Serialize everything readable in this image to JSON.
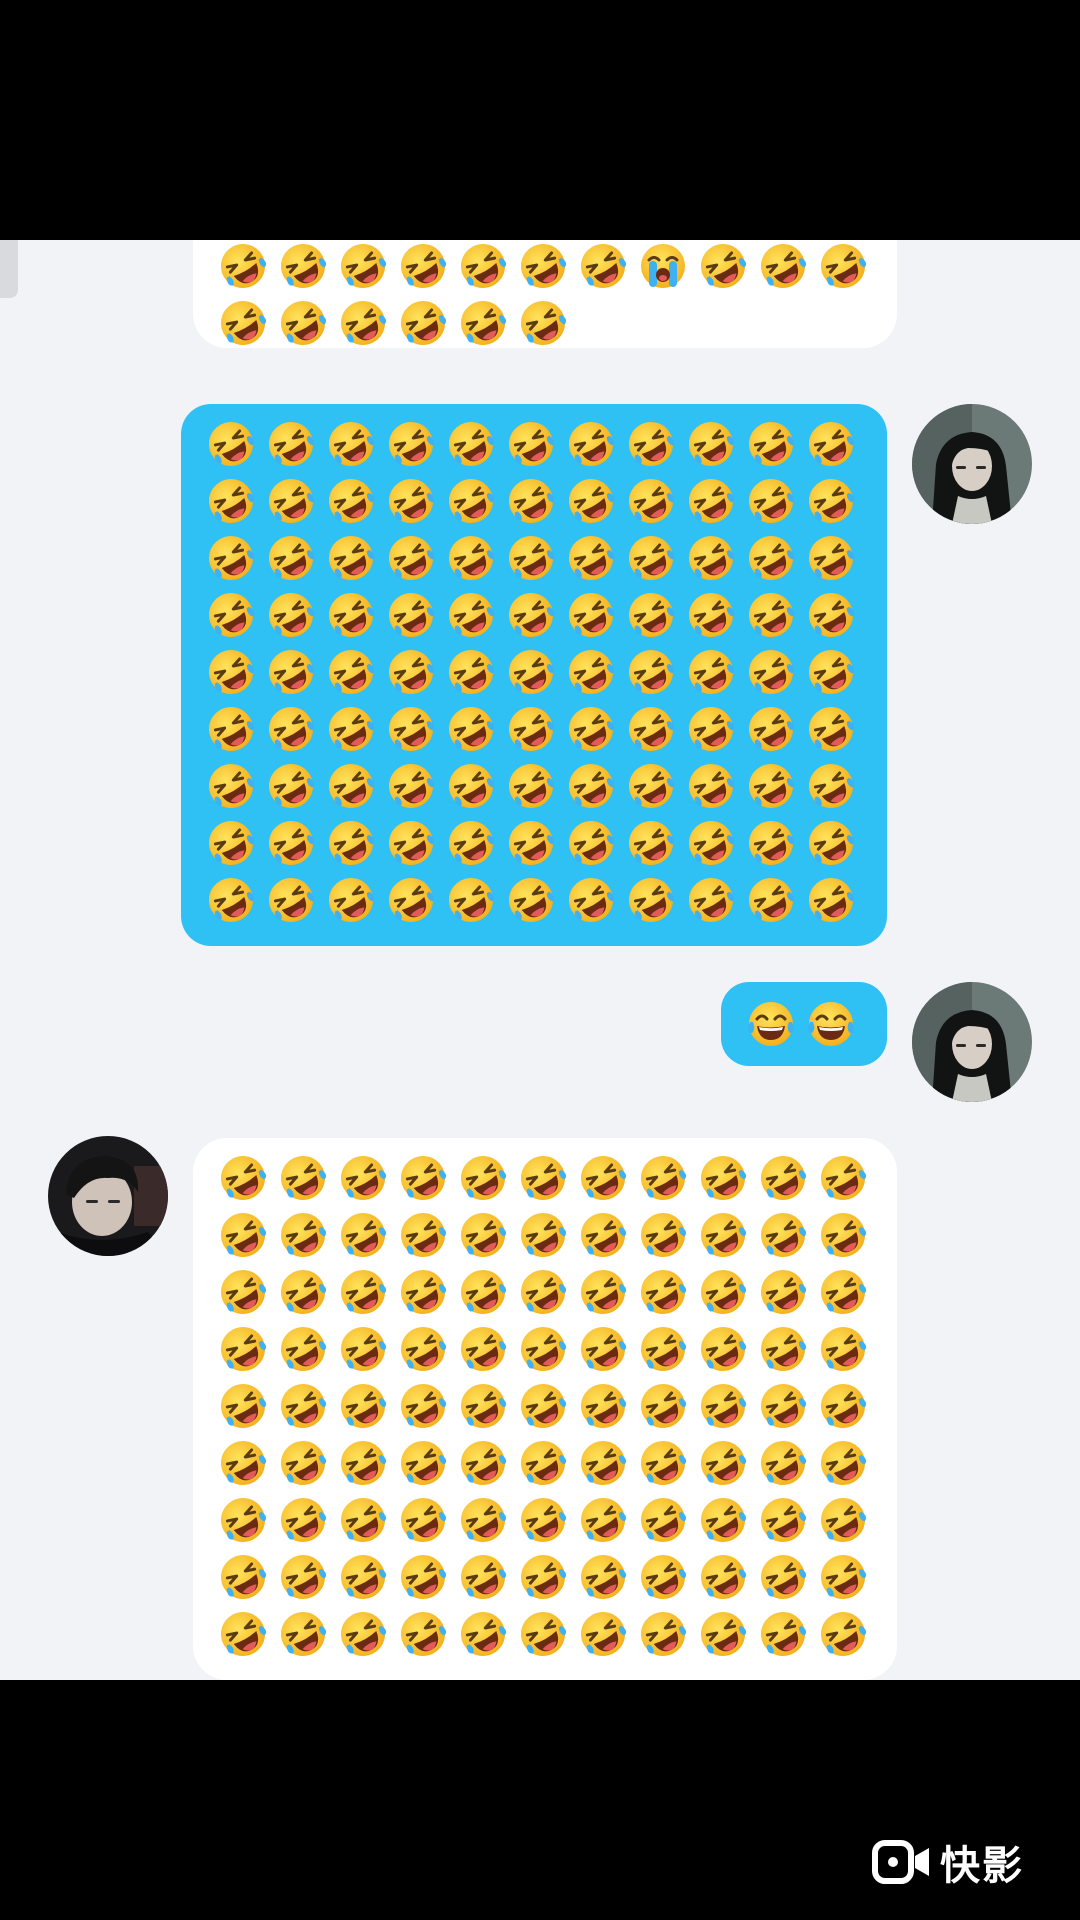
{
  "colors": {
    "chat_background": "#f1f3f7",
    "incoming_bubble": "#ffffff",
    "outgoing_bubble": "#2fc1f4",
    "frame": "#000000"
  },
  "messages": [
    {
      "sender": "contact",
      "kind": "emoji-grid",
      "rows_visible_partial": true,
      "rows": [
        [
          "rofl",
          "rofl",
          "rofl",
          "rofl",
          "rofl",
          "rofl",
          "rofl",
          "loudly-crying",
          "rofl",
          "rofl",
          "rofl"
        ],
        [
          "rofl",
          "rofl",
          "rofl",
          "rofl",
          "rofl",
          "rofl"
        ]
      ]
    },
    {
      "sender": "me",
      "kind": "emoji-grid",
      "emoji": "rofl",
      "row_count": 9,
      "per_row": 11
    },
    {
      "sender": "me",
      "kind": "emoji-row",
      "emojis": [
        "tears-of-joy",
        "tears-of-joy"
      ]
    },
    {
      "sender": "contact",
      "kind": "emoji-grid",
      "emoji": "rofl",
      "row_count": 9,
      "per_row": 11
    }
  ],
  "avatars": {
    "me": "avatar-girl-long-hair",
    "contact": "avatar-boy"
  },
  "watermark": {
    "icon": "video-camera-icon",
    "text": "快影"
  }
}
